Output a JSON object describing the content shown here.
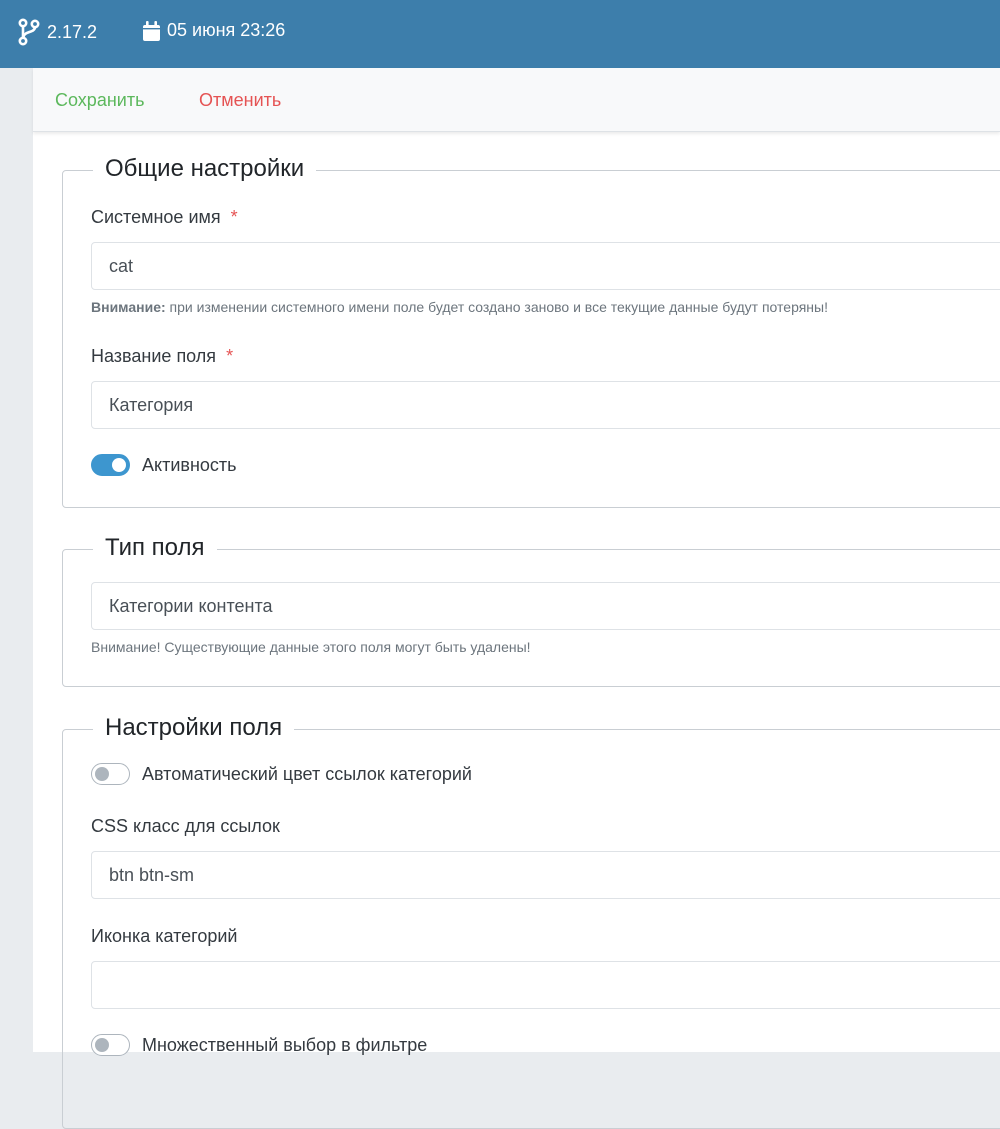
{
  "topbar": {
    "version": "2.17.2",
    "datetime": "05 июня 23:26",
    "bg_color": "#3d7eab",
    "icons": [
      "code-branch-icon",
      "calendar-icon"
    ]
  },
  "toolbar": {
    "save_label": "Сохранить",
    "cancel_label": "Отменить",
    "save_color": "#5cb85c",
    "cancel_color": "#e55353"
  },
  "general": {
    "legend": "Общие настройки",
    "system_name": {
      "label": "Системное имя",
      "required_mark": "*",
      "value": "cat",
      "warning_bold": "Внимание:",
      "warning_text": " при изменении системного имени поле будет создано заново и все текущие данные будут потеряны!"
    },
    "field_title": {
      "label": "Название поля",
      "required_mark": "*",
      "value": "Категория"
    },
    "active": {
      "label": "Активность",
      "checked": true
    }
  },
  "field_type": {
    "legend": "Тип поля",
    "value": "Категории контента",
    "warning": "Внимание! Существующие данные этого поля могут быть удалены!"
  },
  "field_settings": {
    "legend": "Настройки поля",
    "auto_color": {
      "label": "Автоматический цвет ссылок категорий",
      "checked": false
    },
    "css_class": {
      "label": "CSS класс для ссылок",
      "value": "btn btn-sm"
    },
    "icon": {
      "label": "Иконка категорий",
      "value": ""
    },
    "multi_select": {
      "label": "Множественный выбор в фильтре",
      "checked": false
    }
  }
}
